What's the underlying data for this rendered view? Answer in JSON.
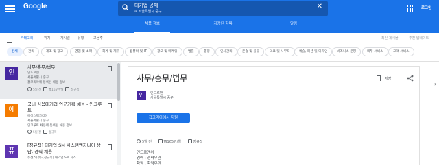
{
  "header": {
    "logo": "Google",
    "search_query": "대기업 공채",
    "search_location": "⊕ 서울특별시 중구",
    "clear_icon": "close-icon",
    "login_label": "로그인"
  },
  "top_tabs": [
    {
      "label": "채용 정보",
      "active": true
    },
    {
      "label": "저장된 항목",
      "active": false
    },
    {
      "label": "알림",
      "active": false
    }
  ],
  "filter_tabs": [
    {
      "label": "카테고리",
      "active": true
    },
    {
      "label": "위치",
      "active": false
    },
    {
      "label": "게시일",
      "active": false
    },
    {
      "label": "유형",
      "active": false
    },
    {
      "label": "고용주",
      "active": false
    }
  ],
  "filter_right": [
    "최신 게시물",
    "추천 업데이트"
  ],
  "category_chips": [
    {
      "label": "전체",
      "active": true
    },
    {
      "label": "관리",
      "active": false
    },
    {
      "label": "제조 및 창고",
      "active": false
    },
    {
      "label": "영업 및 소매",
      "active": false
    },
    {
      "label": "회계 및 재무",
      "active": false
    },
    {
      "label": "컴퓨터 및 IT",
      "active": false
    },
    {
      "label": "광고 및 마케팅",
      "active": false
    },
    {
      "label": "법률",
      "active": false
    },
    {
      "label": "행정",
      "active": false
    },
    {
      "label": "인사관리",
      "active": false
    },
    {
      "label": "운송 및 물류",
      "active": false
    },
    {
      "label": "의료 및 사무직",
      "active": false
    },
    {
      "label": "예술, 패션 및 디자인",
      "active": false
    },
    {
      "label": "비즈니스 운영",
      "active": false
    },
    {
      "label": "외부 서비스",
      "active": false
    },
    {
      "label": "고객 서비스",
      "active": false
    }
  ],
  "job_list": [
    {
      "avatar_letter": "인",
      "avatar_color": "#4527a0",
      "title": "사무/총무/법무",
      "company": "인드로맨",
      "location": "서울특별시 중구",
      "source": "잡코리아에 등록된 채용 정보",
      "posted": "5일 전",
      "salary": "₩165만/월",
      "type": "정규직",
      "selected": true
    },
    {
      "avatar_letter": "에",
      "avatar_color": "#f57c00",
      "title": "국내 식음대기업 연구기획 채용 - 인크루트",
      "company": "에이스펙코리아",
      "location": "서울특별시 중구",
      "source": "인크루트 채용에 등록된 채용 정보",
      "posted": "5일 전",
      "salary": "",
      "type": "정규직",
      "selected": false
    },
    {
      "avatar_letter": "퓨",
      "avatar_color": "#5e35b1",
      "title": "[정규직] 대기업 SM 시스템엔지니어 상담, 경력 채용",
      "company": "퓨젠스(주)-[정규직] 대기업 SM 시스...",
      "location": "",
      "source": "",
      "posted": "",
      "salary": "",
      "type": "",
      "selected": false
    }
  ],
  "detail": {
    "title": "사무/총무/법무",
    "save_label": "저장",
    "avatar_letter": "인",
    "company": "인드로맨",
    "location": "서울특별시 중구",
    "apply_button": "잡코리아에서 지원",
    "posted": "5일 전",
    "salary": "₩165만/월",
    "type": "정규직",
    "body": [
      "인드로맨위",
      "경력 : 경력무관",
      "학력 : 학력무관"
    ]
  }
}
